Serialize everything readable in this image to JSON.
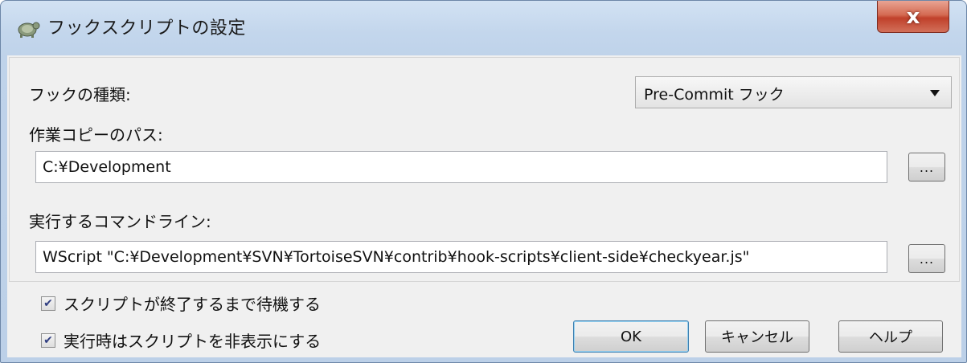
{
  "window": {
    "title": "フックスクリプトの設定",
    "app_icon": "tortoise-icon",
    "close_label": "x"
  },
  "form": {
    "hook_type_label": "フックの種類:",
    "hook_type_value": "Pre-Commit フック",
    "working_copy_label": "作業コピーのパス:",
    "working_copy_value": "C:¥Development",
    "browse_label": "...",
    "command_line_label": "実行するコマンドライン:",
    "command_line_value": "WScript \"C:¥Development¥SVN¥TortoiseSVN¥contrib¥hook-scripts¥client-side¥checkyear.js\""
  },
  "options": {
    "wait_label": "スクリプトが終了するまで待機する",
    "wait_checked": true,
    "hide_label": "実行時はスクリプトを非表示にする",
    "hide_checked": true
  },
  "buttons": {
    "ok": "OK",
    "cancel": "キャンセル",
    "help": "ヘルプ"
  },
  "colors": {
    "title_gradient": "#c3d6ec",
    "close_red": "#c0402a",
    "dialog_bg": "#f0f0f0"
  }
}
